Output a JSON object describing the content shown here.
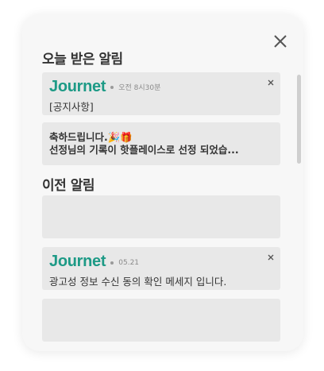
{
  "sections": {
    "today_title": "오늘 받은 알림",
    "previous_title": "이전 알림"
  },
  "notifications": {
    "today": [
      {
        "brand": "Journet",
        "time": "오전 8시30분",
        "message": "[공지사항]"
      },
      {
        "line1": "축하드립니다.🎉🎁",
        "line2": "선정님의 기록이 핫플레이스로 선정 되었습..."
      }
    ],
    "previous": [
      {
        "brand": "Journet",
        "time": "05.21",
        "message": "광고성 정보 수신 동의 확인 메세지 입니다."
      }
    ]
  },
  "icons": {
    "close": "close-icon",
    "dismiss": "dismiss-icon"
  },
  "colors": {
    "brand": "#1d9a86",
    "card_bg": "#e8e8e8",
    "panel_bg": "#f7f7f7"
  }
}
